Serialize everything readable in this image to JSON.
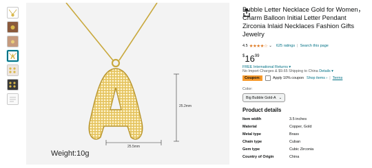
{
  "product": {
    "title": "Bubble Letter Necklace Gold for Women，Charm Balloon Initial Letter Pendant Zirconia Inlaid Necklaces Fashion Gifts Jewelry",
    "rating_value": "4.5",
    "stars": "★★★★☆",
    "ratings_count": "625 ratings",
    "search_link": "Search this page",
    "price_symbol": "$",
    "price_whole": "16",
    "price_fraction": "99",
    "returns_text": "FREE International Returns ▾",
    "shipping_text": "No Import Charges & $9.65 Shipping to China",
    "shipping_details_link": "Details ▾",
    "coupon_badge": "Coupon:",
    "coupon_text": "Apply 10% coupon",
    "shop_items_link": "Shop items ›",
    "terms_link": "Terms",
    "color_label": "Color:",
    "color_selected": "Big Bubble Gold-A"
  },
  "image": {
    "weight_label": "Weight:10g",
    "height_dim": "25.2mm",
    "width_dim": "25.5mm"
  },
  "details": {
    "heading": "Product details",
    "rows": [
      {
        "key": "Item width",
        "value": "3.5 inches"
      },
      {
        "key": "Material",
        "value": "Copper, Gold"
      },
      {
        "key": "Metal type",
        "value": "Brass"
      },
      {
        "key": "Chain type",
        "value": "Cuban"
      },
      {
        "key": "Gem type",
        "value": "Cubic Zirconia"
      },
      {
        "key": "Country of Origin",
        "value": "China"
      }
    ]
  },
  "colors": {
    "link": "#007185",
    "star": "#de7921",
    "coupon": "#f79a2b",
    "gold": "#d9b84a"
  }
}
